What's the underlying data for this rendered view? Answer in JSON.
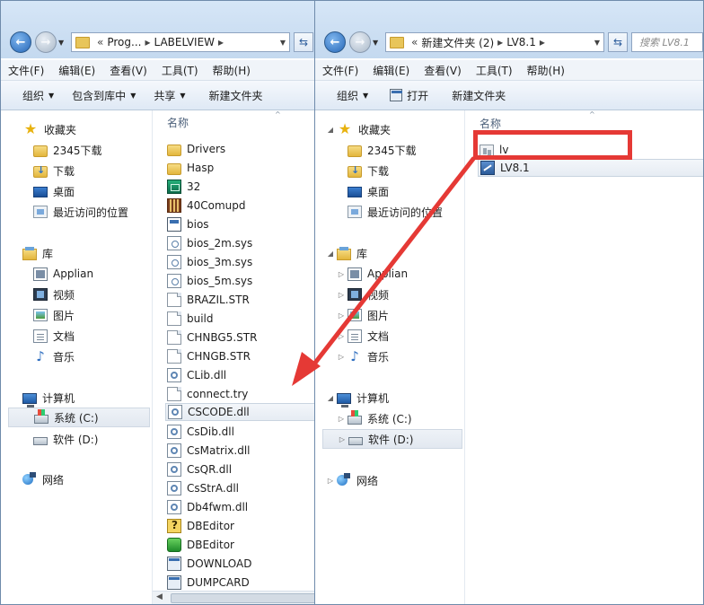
{
  "colors": {
    "accent": "#e53935"
  },
  "left": {
    "address": {
      "chevrons": "«",
      "segments": [
        "Prog...",
        "LABELVIEW"
      ]
    },
    "menu": [
      "文件(F)",
      "编辑(E)",
      "查看(V)",
      "工具(T)",
      "帮助(H)"
    ],
    "toolbar": [
      "组织",
      "包含到库中",
      "共享",
      "新建文件夹"
    ],
    "nav": {
      "favorites": "收藏夹",
      "fav_items": [
        "2345下载",
        "下载",
        "桌面",
        "最近访问的位置"
      ],
      "libraries": "库",
      "lib_items": [
        "Applian",
        "视频",
        "图片",
        "文档",
        "音乐"
      ],
      "computer": "计算机",
      "drives": [
        "系统 (C:)",
        "软件 (D:)"
      ],
      "network": "网络"
    },
    "column_header": "名称",
    "files": [
      "Drivers",
      "Hasp",
      "32",
      "40Comupd",
      "bios",
      "bios_2m.sys",
      "bios_3m.sys",
      "bios_5m.sys",
      "BRAZIL.STR",
      "build",
      "CHNBG5.STR",
      "CHNGB.STR",
      "CLib.dll",
      "connect.try",
      "CSCODE.dll",
      "CsDib.dll",
      "CsMatrix.dll",
      "CsQR.dll",
      "CsStrA.dll",
      "Db4fwm.dll",
      "DBEditor",
      "DBEditor",
      "DOWNLOAD",
      "DUMPCARD"
    ]
  },
  "right": {
    "address": {
      "chevrons": "«",
      "segments": [
        "新建文件夹 (2)",
        "LV8.1"
      ]
    },
    "search_placeholder": "搜索 LV8.1",
    "menu": [
      "文件(F)",
      "编辑(E)",
      "查看(V)",
      "工具(T)",
      "帮助(H)"
    ],
    "toolbar": [
      "组织",
      "打开",
      "新建文件夹"
    ],
    "nav": {
      "favorites": "收藏夹",
      "fav_items": [
        "2345下载",
        "下载",
        "桌面",
        "最近访问的位置"
      ],
      "libraries": "库",
      "lib_items": [
        "Applian",
        "视频",
        "图片",
        "文档",
        "音乐"
      ],
      "computer": "计算机",
      "drives": [
        "系统 (C:)",
        "软件 (D:)"
      ],
      "network": "网络"
    },
    "column_header": "名称",
    "files": [
      "lv",
      "LV8.1"
    ]
  }
}
